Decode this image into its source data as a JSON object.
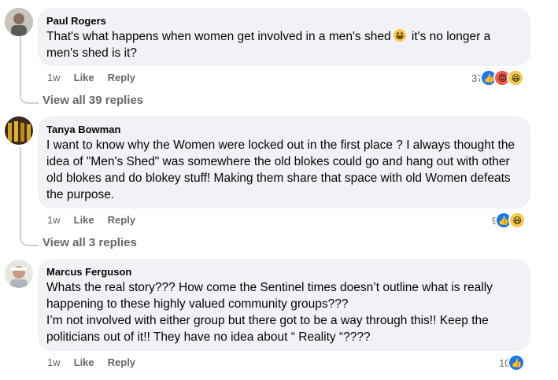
{
  "comments": [
    {
      "name": "Paul Rogers",
      "text_before": "That's what happens when women get involved in a men's shed",
      "text_after": " it's no longer a men's shed is it?",
      "time": "1w",
      "like": "Like",
      "reply": "Reply",
      "reaction_count": "37",
      "reactions": [
        "like-icon",
        "angry-icon",
        "haha-icon"
      ],
      "view_replies": "View all 39 replies"
    },
    {
      "name": "Tanya Bowman",
      "text": "I want to know why the Women were locked out in the first place ? I always thought the idea of \"Men's Shed\" was somewhere the old blokes could go and hang out with other old blokes and do blokey stuff! Making them share that space with old Women defeats the purpose.",
      "time": "1w",
      "like": "Like",
      "reply": "Reply",
      "reaction_count": "9",
      "reactions": [
        "like-icon",
        "haha-icon"
      ],
      "view_replies": "View all 3 replies"
    },
    {
      "name": "Marcus Ferguson",
      "text_line1": "Whats the real story??? How come the Sentinel times doesn’t outline what is really happening to these highly valued community groups???",
      "text_line2": "I’m not involved with either group but there got to be a way through this!! Keep the politicians out of it!! They have no idea about “ Reality “????",
      "time": "1w",
      "like": "Like",
      "reply": "Reply",
      "reaction_count": "10",
      "reactions": [
        "like-icon"
      ]
    }
  ]
}
